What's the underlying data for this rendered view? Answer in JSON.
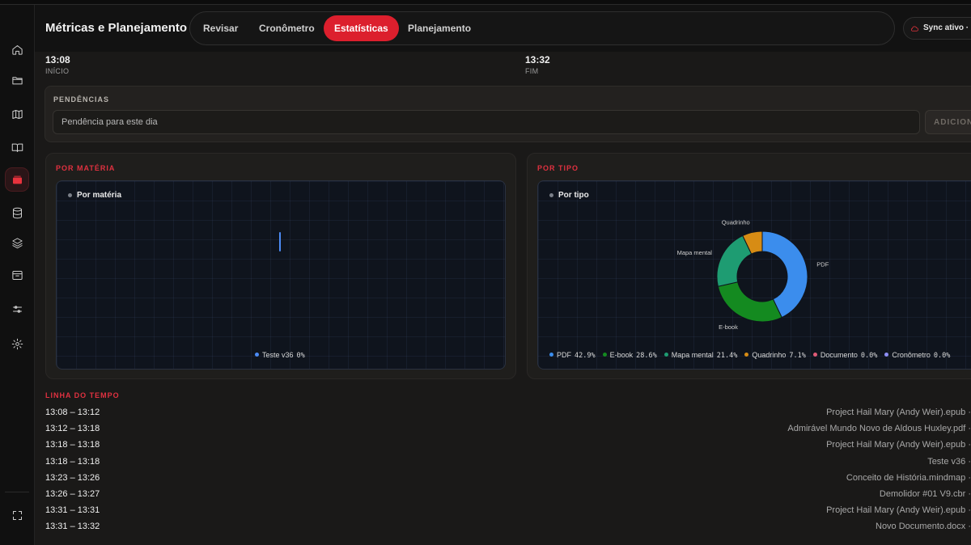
{
  "header": {
    "title": "Métricas e Planejamento",
    "tabs": [
      {
        "label": "Revisar",
        "active": false
      },
      {
        "label": "Cronômetro",
        "active": false
      },
      {
        "label": "Estatísticas",
        "active": true
      },
      {
        "label": "Planejamento",
        "active": false
      }
    ],
    "sync_label": "Sync ativo · a"
  },
  "sidebar": {
    "items": [
      {
        "icon": "home-icon",
        "active": false
      },
      {
        "icon": "folder-icon",
        "active": false
      },
      {
        "icon": "map-icon",
        "active": false
      },
      {
        "icon": "book-open-icon",
        "active": false
      },
      {
        "icon": "cards-icon",
        "active": true
      },
      {
        "icon": "database-icon",
        "active": false
      },
      {
        "icon": "layers-icon",
        "active": false
      },
      {
        "icon": "archive-icon",
        "active": false
      },
      {
        "icon": "sliders-icon",
        "active": false
      },
      {
        "icon": "gear-icon",
        "active": false
      },
      {
        "icon": "fullscreen-icon",
        "active": false
      }
    ]
  },
  "session": {
    "start_time": "13:08",
    "start_label": "INÍCIO",
    "end_time": "13:32",
    "end_label": "FIM"
  },
  "pendencias": {
    "label": "PENDÊNCIAS",
    "placeholder": "Pendência para este dia",
    "button_label": "ADICIONAR"
  },
  "por_materia": {
    "section_label": "POR MATÉRIA",
    "chart_title": "Por matéria",
    "chart_data": {
      "type": "bar",
      "categories": [
        "Teste v36"
      ],
      "values": [
        0
      ],
      "legend": [
        {
          "name": "Teste v36",
          "pct": "0%",
          "color": "#4c8bf5"
        }
      ]
    }
  },
  "por_tipo": {
    "section_label": "POR TIPO",
    "chart_title": "Por tipo",
    "chart_data": {
      "type": "pie",
      "donut": true,
      "slices": [
        {
          "name": "PDF",
          "value": 42.9,
          "pct": "42.9%",
          "color": "#3b8ded"
        },
        {
          "name": "E-book",
          "value": 28.6,
          "pct": "28.6%",
          "color": "#148a20"
        },
        {
          "name": "Mapa mental",
          "value": 21.4,
          "pct": "21.4%",
          "color": "#1e9c72"
        },
        {
          "name": "Quadrinho",
          "value": 7.1,
          "pct": "7.1%",
          "color": "#d78c14"
        },
        {
          "name": "Documento",
          "value": 0.0,
          "pct": "0.0%",
          "color": "#e05a76"
        },
        {
          "name": "Cronômetro",
          "value": 0.0,
          "pct": "0.0%",
          "color": "#8e8ef5"
        }
      ]
    }
  },
  "timeline": {
    "label": "LINHA DO TEMPO",
    "entries": [
      {
        "time": "13:08 – 13:12",
        "file": "Project Hail Mary (Andy Weir).epub ·"
      },
      {
        "time": "13:12 – 13:18",
        "file": "Admirável Mundo Novo de Aldous Huxley.pdf ·"
      },
      {
        "time": "13:18 – 13:18",
        "file": "Project Hail Mary (Andy Weir).epub ·"
      },
      {
        "time": "13:18 – 13:18",
        "file": "Teste v36 ·"
      },
      {
        "time": "13:23 – 13:26",
        "file": "Conceito de História.mindmap ·"
      },
      {
        "time": "13:26 – 13:27",
        "file": "Demolidor #01 V9.cbr ·"
      },
      {
        "time": "13:31 – 13:31",
        "file": "Project Hail Mary (Andy Weir).epub ·"
      },
      {
        "time": "13:31 – 13:32",
        "file": "Novo Documento.docx ·"
      }
    ]
  },
  "colors": {
    "accent": "#dc1f2d",
    "section_label": "#e03140",
    "background": "#1a1918"
  }
}
